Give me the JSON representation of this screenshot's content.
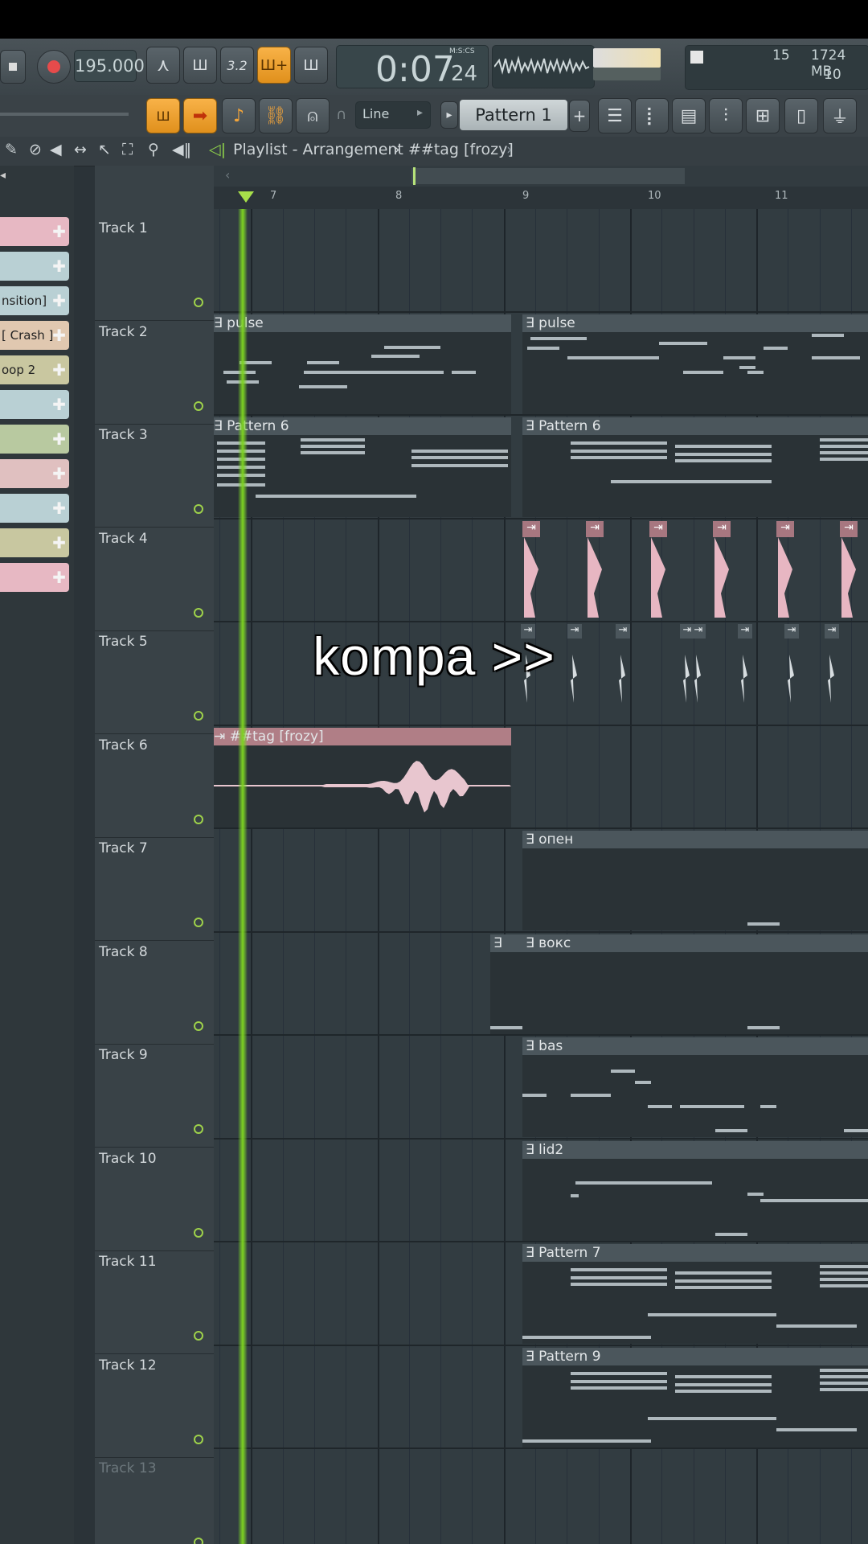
{
  "transport": {
    "tempo": "195.000",
    "time": "0:07",
    "time_cs": "24",
    "time_mode": "M:S:CS",
    "mem_left": "15",
    "mem_right": "1724 MB",
    "cpu": "10"
  },
  "toolbar": {
    "snap_mode": "Line",
    "pattern_name": "Pattern 1",
    "plus_label": "+"
  },
  "playlist": {
    "title": "Playlist - Arrangement",
    "separator": "›",
    "clip_title": "##tag [frozy]"
  },
  "ruler": {
    "marks": [
      "7",
      "8",
      "9",
      "10",
      "11"
    ]
  },
  "channels": [
    "",
    "",
    "nsition]",
    "[ Crash ]",
    "oop 2",
    "",
    "",
    "",
    "",
    "",
    ""
  ],
  "tracks": [
    "Track 1",
    "Track 2",
    "Track 3",
    "Track 4",
    "Track 5",
    "Track 6",
    "Track 7",
    "Track 8",
    "Track 9",
    "Track 10",
    "Track 11",
    "Track 12",
    "Track 13"
  ],
  "clips": {
    "t2a": "pulse",
    "t2b": "pulse",
    "t3a": "Pattern 6",
    "t3b": "Pattern 6",
    "t6a": "##tag [frozy]",
    "t7b": "опен",
    "t8b": "вокс",
    "t9b": "bas",
    "t10b": "lid2",
    "t11b": "Pattern 7",
    "t12b": "Pattern 9"
  },
  "overlay_text": "kompa >>",
  "colors": {
    "accent_orange": "#f2a43a",
    "playhead_green": "#7ed321",
    "clip_audio_pink": "#e7b6c2"
  }
}
